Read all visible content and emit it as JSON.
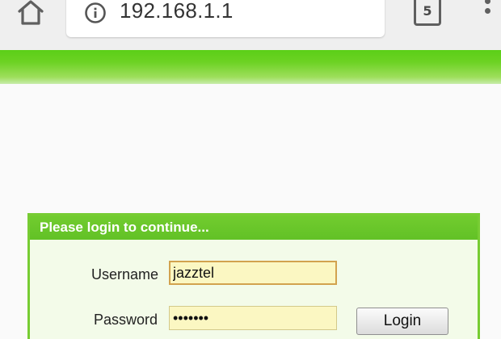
{
  "browser": {
    "url": "192.168.1.1",
    "tab_count": "5",
    "icons": {
      "home": "home-icon",
      "info": "info-icon",
      "tabs": "tabs-icon",
      "menu": "more-vert-icon"
    }
  },
  "colors": {
    "banner": "#6cd223",
    "panel_border": "#77cc33",
    "panel_header": "#6bc62b",
    "panel_body": "#f3fbe9",
    "input_fill": "#fbf7c2"
  },
  "login": {
    "header": "Please login to continue...",
    "username_label": "Username",
    "username_value": "jazztel",
    "password_label": "Password",
    "password_value": "•••••••",
    "button_label": "Login"
  }
}
